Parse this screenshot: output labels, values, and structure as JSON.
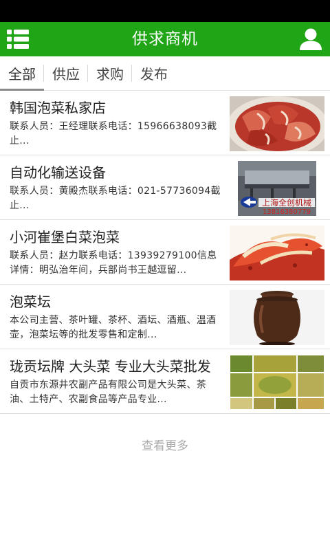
{
  "header": {
    "title": "供求商机",
    "menu_icon": "list-menu-icon",
    "user_icon": "user-icon",
    "color": "#1fa515"
  },
  "tabs": [
    {
      "label": "全部",
      "active": true
    },
    {
      "label": "供应",
      "active": false
    },
    {
      "label": "求购",
      "active": false
    },
    {
      "label": "发布",
      "active": false
    }
  ],
  "items": [
    {
      "title": "韩国泡菜私家店",
      "desc": "联系人员：王经理联系电话：15966638093截止..."
    },
    {
      "title": "自动化输送设备",
      "desc": "联系人员：黄殿杰联系电话：021-57736094截止...",
      "image_text": "上海全创机械",
      "image_phone": "13816380779"
    },
    {
      "title": "小河崔堡白菜泡菜",
      "desc": "联系人员：赵力联系电话：13939279100信息详情：明弘治年间，兵部尚书王越逗留..."
    },
    {
      "title": "泡菜坛",
      "desc": "本公司主营、茶叶罐、茶杯、酒坛、酒瓶、温酒壶，泡菜坛等的批发零售和定制..."
    },
    {
      "title": "珑贡坛牌 大头菜 专业大头菜批发",
      "desc": "自贡市东源井农副产品有限公司是大头菜、茶油、土特产、农副食品等产品专业..."
    }
  ],
  "more_label": "查看更多"
}
